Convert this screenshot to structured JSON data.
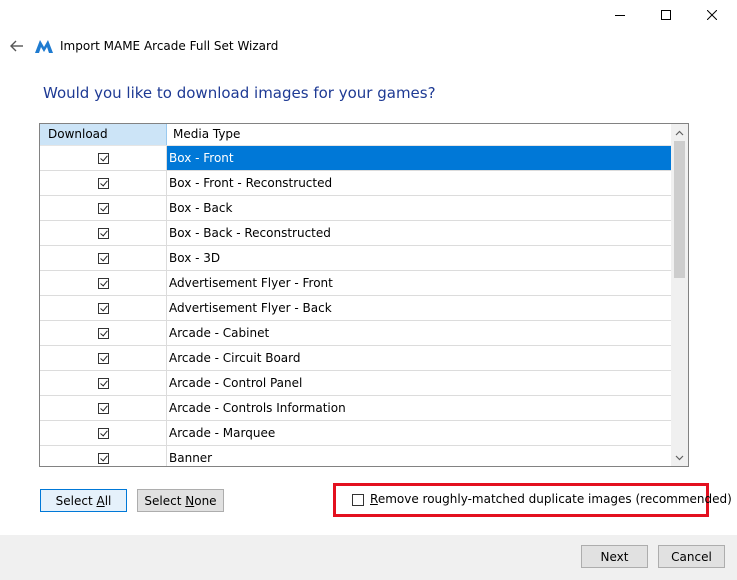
{
  "window": {
    "title": "Import MAME Arcade Full Set Wizard",
    "controls": [
      "minimize-icon",
      "maximize-icon",
      "close-icon"
    ]
  },
  "icons": {
    "back": "arrow-left-icon",
    "logo": "launchbox-logo"
  },
  "heading": "Would you like to download images for your games?",
  "accent_color": "#0078d7",
  "heading_color": "#1e3a94",
  "highlight_color": "#e3101f",
  "grid": {
    "headers": {
      "download": "Download",
      "media_type": "Media Type"
    },
    "selected_index": 0,
    "rows": [
      {
        "checked": true,
        "media_type": "Box - Front"
      },
      {
        "checked": true,
        "media_type": "Box - Front - Reconstructed"
      },
      {
        "checked": true,
        "media_type": "Box - Back"
      },
      {
        "checked": true,
        "media_type": "Box - Back - Reconstructed"
      },
      {
        "checked": true,
        "media_type": "Box - 3D"
      },
      {
        "checked": true,
        "media_type": "Advertisement Flyer - Front"
      },
      {
        "checked": true,
        "media_type": "Advertisement Flyer - Back"
      },
      {
        "checked": true,
        "media_type": "Arcade - Cabinet"
      },
      {
        "checked": true,
        "media_type": "Arcade - Circuit Board"
      },
      {
        "checked": true,
        "media_type": "Arcade - Control Panel"
      },
      {
        "checked": true,
        "media_type": "Arcade - Controls Information"
      },
      {
        "checked": true,
        "media_type": "Arcade - Marquee"
      },
      {
        "checked": true,
        "media_type": "Banner"
      }
    ]
  },
  "buttons": {
    "select_all_prefix": "Select ",
    "select_all_access": "A",
    "select_all_suffix": "ll",
    "select_none_prefix": "Select ",
    "select_none_access": "N",
    "select_none_suffix": "one",
    "next": "Next",
    "cancel": "Cancel"
  },
  "duplicate_option": {
    "checked": false,
    "label_access": "R",
    "label_rest": "emove roughly-matched duplicate images (recommended)"
  }
}
